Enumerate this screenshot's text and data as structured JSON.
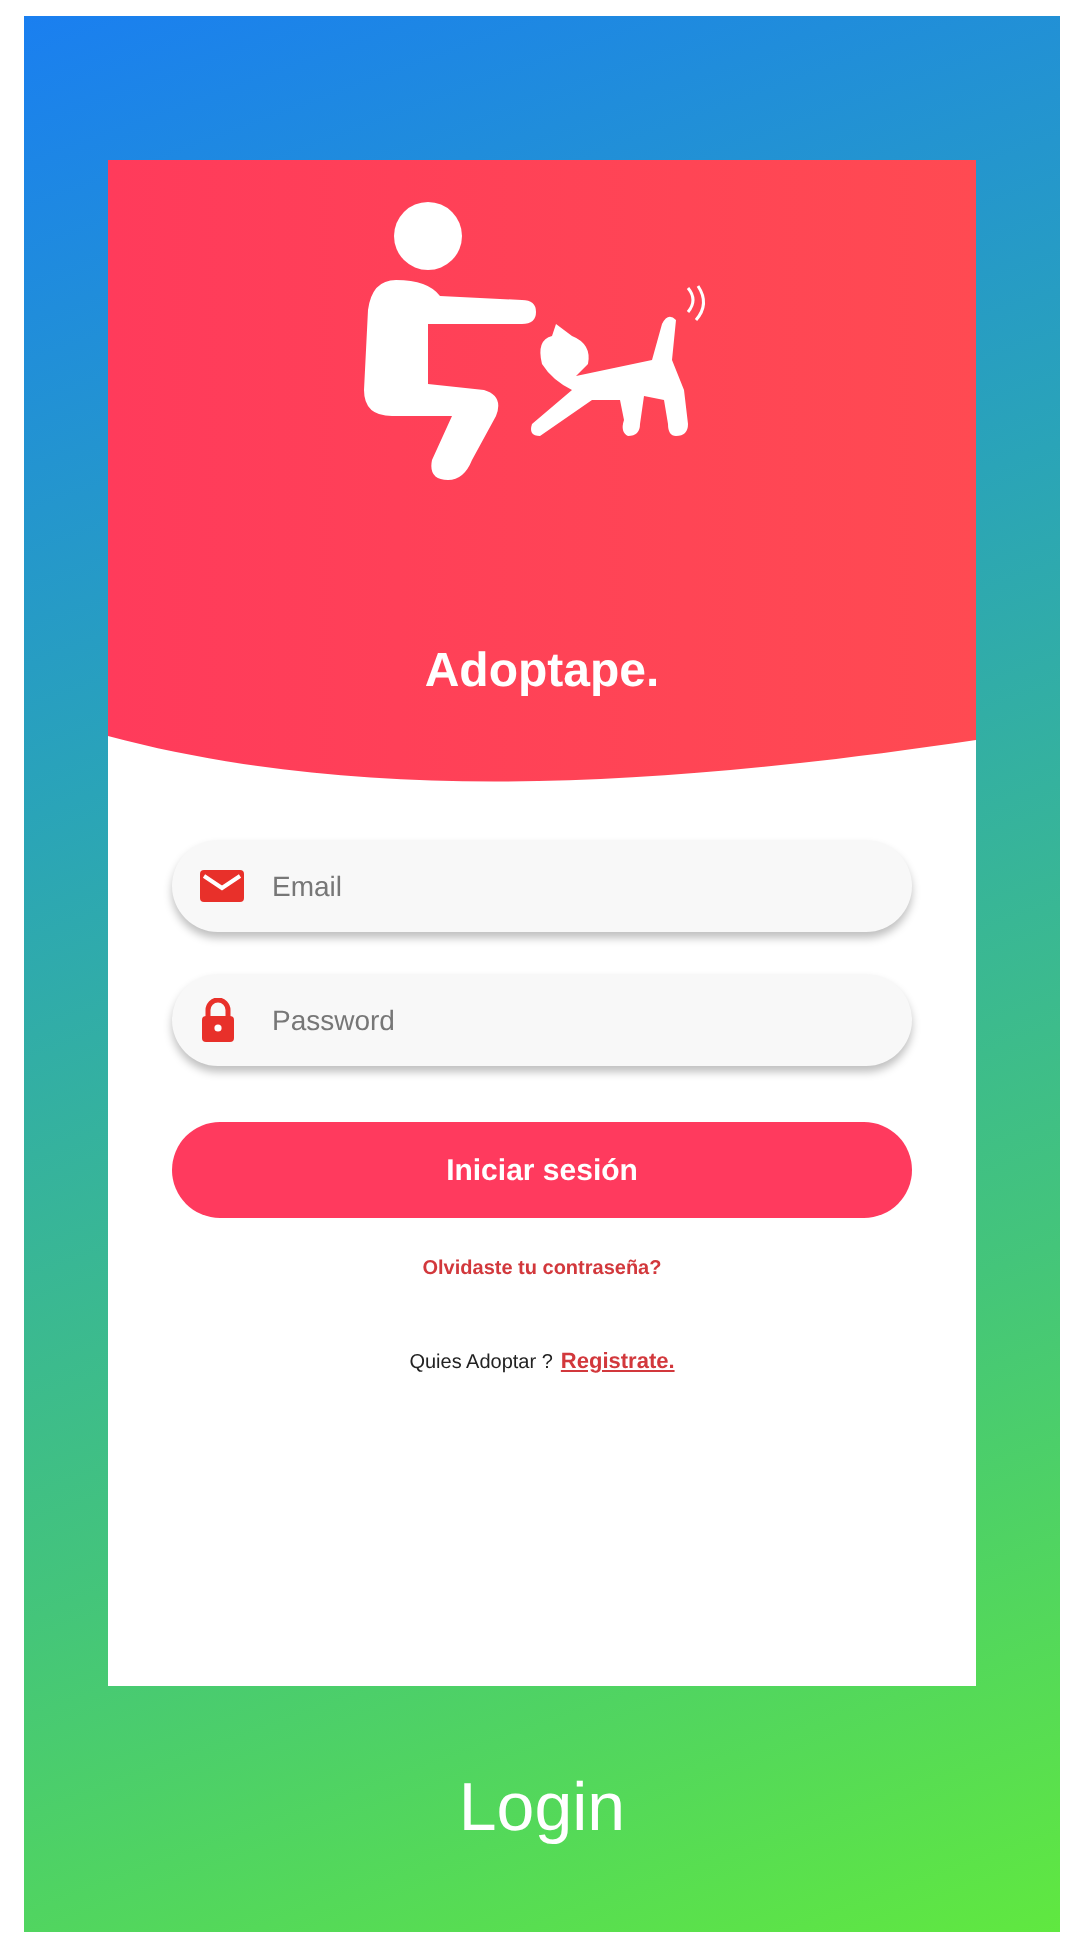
{
  "app": {
    "title": "Adoptape."
  },
  "fields": [
    {
      "kind": "email",
      "placeholder": "Email"
    },
    {
      "kind": "password",
      "placeholder": "Password"
    }
  ],
  "submit": {
    "label": "Iniciar sesión"
  },
  "forgot_link": "Olvidaste tu contraseña?",
  "register": {
    "prompt": "Quies Adoptar ?",
    "link": "Registrate."
  },
  "caption": "Login"
}
